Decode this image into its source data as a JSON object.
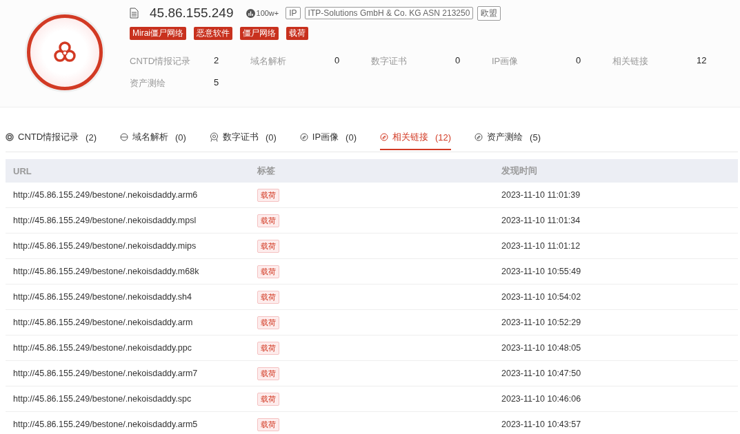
{
  "header": {
    "ip": "45.86.155.249",
    "heat": "100w+",
    "badges": [
      "IP",
      "ITP-Solutions GmbH & Co. KG ASN 213250",
      "欧盟"
    ],
    "tags": [
      "Mirai僵尸网络",
      "恶意软件",
      "僵尸网络",
      "载荷"
    ],
    "stats": [
      {
        "label": "CNTD情报记录",
        "value": "2"
      },
      {
        "label": "域名解析",
        "value": "0"
      },
      {
        "label": "数字证书",
        "value": "0"
      },
      {
        "label": "IP画像",
        "value": "0"
      },
      {
        "label": "相关链接",
        "value": "12"
      },
      {
        "label": "资产测绘",
        "value": "5"
      }
    ]
  },
  "tabs": [
    {
      "label": "CNTD情报记录",
      "count": "(2)",
      "kind": "radar",
      "selected": false
    },
    {
      "label": "域名解析",
      "count": "(0)",
      "kind": "domain",
      "selected": false
    },
    {
      "label": "数字证书",
      "count": "(0)",
      "kind": "cert",
      "selected": false
    },
    {
      "label": "IP画像",
      "count": "(0)",
      "kind": "link",
      "selected": false
    },
    {
      "label": "相关链接",
      "count": "(12)",
      "kind": "link",
      "selected": true
    },
    {
      "label": "资产测绘",
      "count": "(5)",
      "kind": "link",
      "selected": false
    }
  ],
  "table": {
    "columns": [
      "URL",
      "标签",
      "发现时间"
    ],
    "rows": [
      {
        "url": "http://45.86.155.249/bestone/.nekoisdaddy.arm6",
        "tag": "载荷",
        "time": "2023-11-10 11:01:39"
      },
      {
        "url": "http://45.86.155.249/bestone/.nekoisdaddy.mpsl",
        "tag": "载荷",
        "time": "2023-11-10 11:01:34"
      },
      {
        "url": "http://45.86.155.249/bestone/.nekoisdaddy.mips",
        "tag": "载荷",
        "time": "2023-11-10 11:01:12"
      },
      {
        "url": "http://45.86.155.249/bestone/.nekoisdaddy.m68k",
        "tag": "载荷",
        "time": "2023-11-10 10:55:49"
      },
      {
        "url": "http://45.86.155.249/bestone/.nekoisdaddy.sh4",
        "tag": "载荷",
        "time": "2023-11-10 10:54:02"
      },
      {
        "url": "http://45.86.155.249/bestone/.nekoisdaddy.arm",
        "tag": "载荷",
        "time": "2023-11-10 10:52:29"
      },
      {
        "url": "http://45.86.155.249/bestone/.nekoisdaddy.ppc",
        "tag": "载荷",
        "time": "2023-11-10 10:48:05"
      },
      {
        "url": "http://45.86.155.249/bestone/.nekoisdaddy.arm7",
        "tag": "载荷",
        "time": "2023-11-10 10:47:50"
      },
      {
        "url": "http://45.86.155.249/bestone/.nekoisdaddy.spc",
        "tag": "载荷",
        "time": "2023-11-10 10:46:06"
      },
      {
        "url": "http://45.86.155.249/bestone/.nekoisdaddy.arm5",
        "tag": "载荷",
        "time": "2023-11-10 10:43:57"
      }
    ]
  }
}
